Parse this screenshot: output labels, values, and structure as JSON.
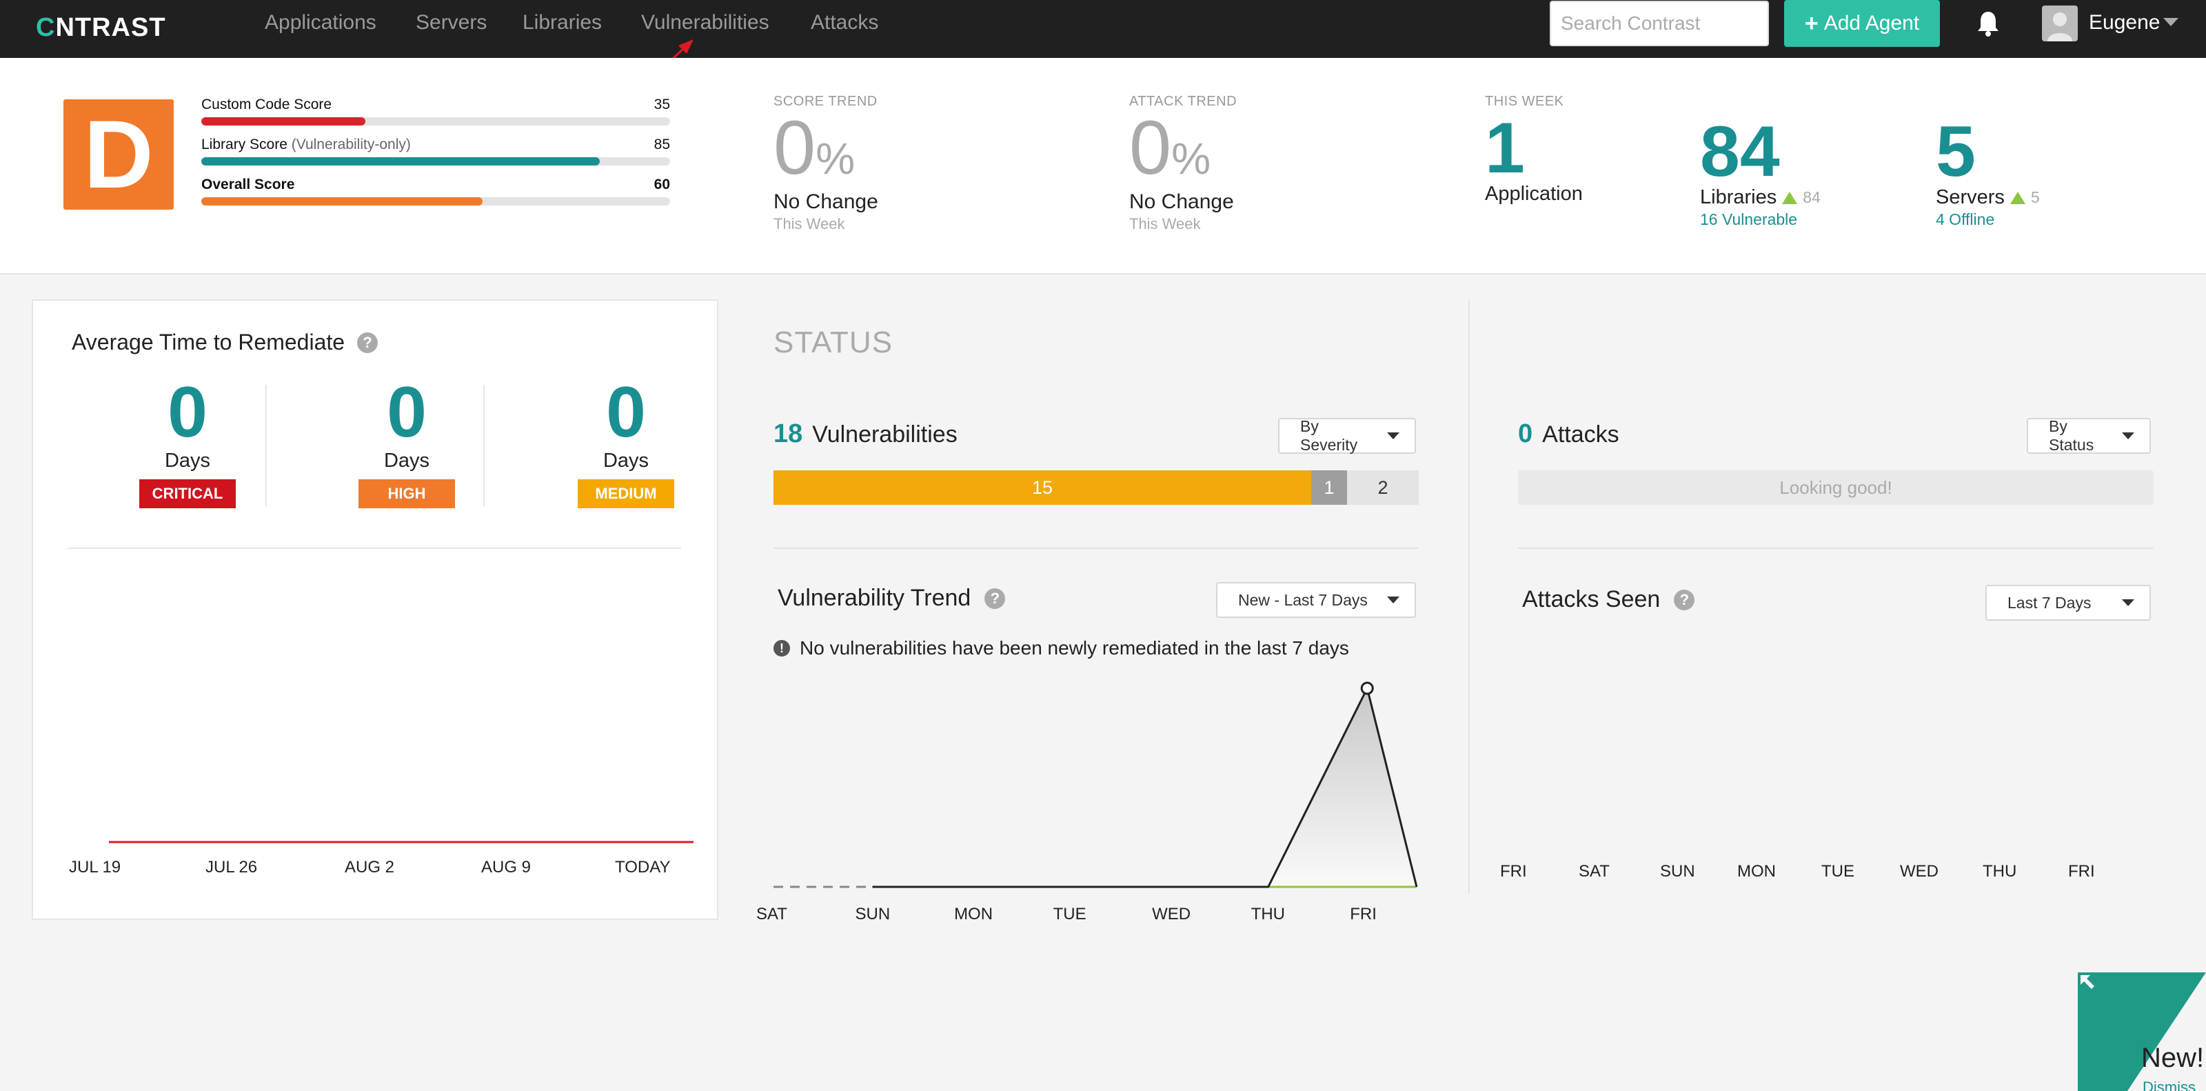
{
  "nav": {
    "logo_c": "C",
    "logo_rest": "NTRAST",
    "links": [
      "Applications",
      "Servers",
      "Libraries",
      "Vulnerabilities",
      "Attacks"
    ],
    "search_placeholder": "Search Contrast",
    "add_agent_label": "Add Agent",
    "user_name": "Eugene"
  },
  "scores": {
    "grade": "D",
    "custom_code": {
      "label": "Custom Code Score",
      "value": "35",
      "fraction": 0.35,
      "color": "#d8232a"
    },
    "library": {
      "label": "Library Score",
      "qualifier": "(Vulnerability-only)",
      "value": "85",
      "fraction": 0.85,
      "color": "#1a8f92"
    },
    "overall": {
      "label": "Overall Score",
      "value": "60",
      "fraction": 0.6,
      "color": "#f07a2a"
    }
  },
  "score_trend": {
    "caption": "SCORE TREND",
    "value": "0",
    "unit": "%",
    "main": "No Change",
    "sub": "This Week"
  },
  "attack_trend": {
    "caption": "ATTACK TREND",
    "value": "0",
    "unit": "%",
    "main": "No Change",
    "sub": "This Week"
  },
  "this_week": {
    "caption": "THIS WEEK",
    "applications": {
      "value": "1",
      "label": "Application"
    },
    "libraries": {
      "value": "84",
      "label": "Libraries",
      "delta": "84",
      "sub": "16 Vulnerable"
    },
    "servers": {
      "value": "5",
      "label": "Servers",
      "delta": "5",
      "sub": "4 Offline"
    }
  },
  "remediate": {
    "title": "Average Time to Remediate",
    "columns": [
      {
        "value": "0",
        "unit": "Days",
        "badge": "CRITICAL",
        "color": "#d0141d"
      },
      {
        "value": "0",
        "unit": "Days",
        "badge": "HIGH",
        "color": "#f07a2a"
      },
      {
        "value": "0",
        "unit": "Days",
        "badge": "MEDIUM",
        "color": "#f5a800"
      }
    ],
    "axis": [
      "JUL 19",
      "JUL 26",
      "AUG 2",
      "AUG 9",
      "TODAY"
    ]
  },
  "status": {
    "title": "STATUS",
    "vulnerabilities": {
      "count": "18",
      "label": "Vulnerabilities",
      "dropdown": "By Severity"
    },
    "severity_bar": [
      {
        "label": "15",
        "value": 15,
        "color": "#f2a90c",
        "text_color": "#ffffff"
      },
      {
        "label": "1",
        "value": 1,
        "color": "#9e9e9e",
        "text_color": "#ffffff"
      },
      {
        "label": "2",
        "value": 2,
        "color": "#e4e4e4",
        "text_color": "#333333"
      }
    ],
    "trend": {
      "title": "Vulnerability Trend",
      "dropdown": "New - Last 7 Days",
      "note": "No vulnerabilities have been newly remediated in the last 7 days",
      "days": [
        "SAT",
        "SUN",
        "MON",
        "TUE",
        "WED",
        "THU",
        "FRI"
      ]
    },
    "attacks": {
      "count": "0",
      "label": "Attacks",
      "dropdown": "By Status",
      "empty": "Looking good!"
    },
    "attacks_seen": {
      "title": "Attacks Seen",
      "dropdown": "Last 7 Days",
      "days": [
        "FRI",
        "SAT",
        "SUN",
        "MON",
        "TUE",
        "WED",
        "THU",
        "FRI"
      ]
    }
  },
  "corner": {
    "new": "New!",
    "dismiss": "Dismiss"
  },
  "chart_data": {
    "type": "area",
    "title": "Vulnerability Trend",
    "categories": [
      "SAT",
      "SUN",
      "MON",
      "TUE",
      "WED",
      "THU",
      "FRI"
    ],
    "series": [
      {
        "values": [
          0,
          0,
          0,
          0,
          0,
          0,
          1
        ]
      }
    ]
  }
}
